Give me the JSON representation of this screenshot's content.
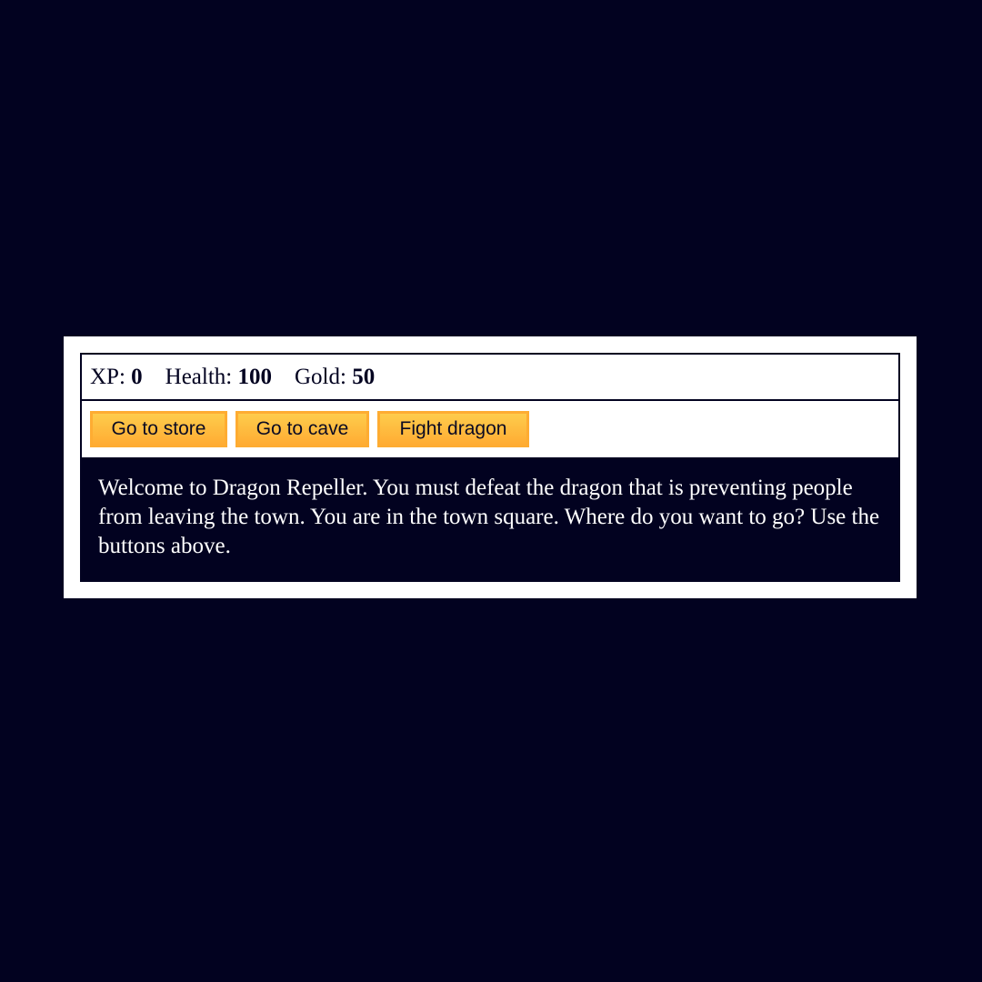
{
  "stats": {
    "xp_label": "XP:",
    "xp_value": "0",
    "health_label": "Health:",
    "health_value": "100",
    "gold_label": "Gold:",
    "gold_value": "50"
  },
  "controls": {
    "store_label": "Go to store",
    "cave_label": "Go to cave",
    "dragon_label": "Fight dragon"
  },
  "message": {
    "text": "Welcome to Dragon Repeller. You must defeat the dragon that is preventing people from leaving the town. You are in the town square. Where do you want to go? Use the buttons above."
  },
  "colors": {
    "background": "#020220",
    "card": "#ffffff",
    "button": "#feac32",
    "text_panel": "#020220"
  }
}
